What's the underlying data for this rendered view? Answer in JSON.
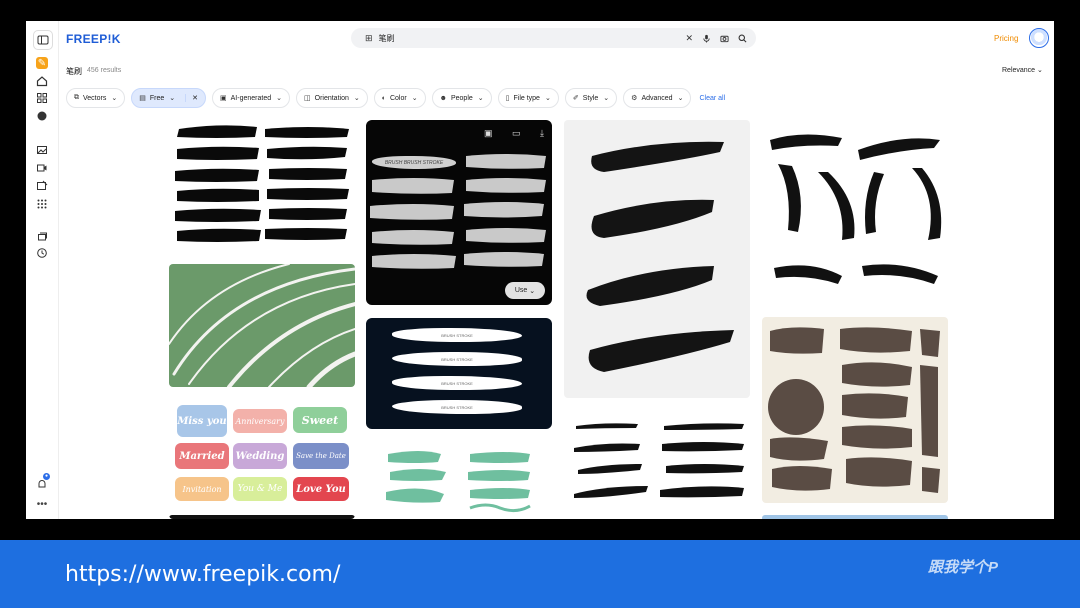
{
  "header": {
    "logo": "FREEP!K",
    "search_query": "笔刷",
    "pricing": "Pricing"
  },
  "results": {
    "title": "笔刷",
    "count": "456 results",
    "sort": "Relevance"
  },
  "filters": [
    {
      "label": "Vectors",
      "icon": "layers-icon"
    },
    {
      "label": "Free",
      "icon": "doc-icon",
      "active": true
    },
    {
      "label": "AI-generated",
      "icon": "ai-icon"
    },
    {
      "label": "Orientation",
      "icon": "orientation-icon"
    },
    {
      "label": "Color",
      "icon": "palette-icon"
    },
    {
      "label": "People",
      "icon": "people-icon"
    },
    {
      "label": "File type",
      "icon": "file-icon"
    },
    {
      "label": "Style",
      "icon": "brush-icon"
    },
    {
      "label": "Advanced",
      "icon": "gear-icon"
    }
  ],
  "clear_all": "Clear all",
  "tiles": {
    "use_button": "Use",
    "brush_stroke_caption": "BRUSH BRUSH STROKE",
    "navy_labels": [
      "BRUSH STROKE",
      "BRUSH STROKE",
      "BRUSH STROKE",
      "BRUSH STROKE"
    ],
    "lettering": [
      "Miss you",
      "Anniversary",
      "Sweet",
      "Married",
      "Wedding",
      "Save the Date",
      "Invitation",
      "You & Me",
      "Love You"
    ]
  },
  "footer": {
    "url": "https://www.freepik.com/",
    "watermark": "跟我学个P"
  },
  "colors": {
    "brand_blue": "#1f5dd6",
    "pricing_orange": "#f08b00",
    "footer_blue": "#1e6fe0",
    "chip_active": "#dfe9fd"
  }
}
